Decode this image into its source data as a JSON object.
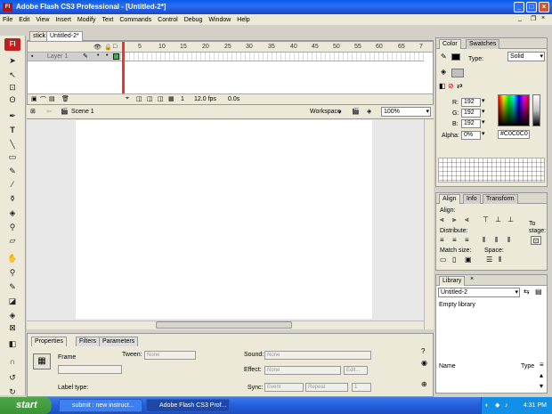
{
  "window": {
    "title": "Adobe Flash CS3 Professional - [Untitled-2*]"
  },
  "menu": [
    "File",
    "Edit",
    "View",
    "Insert",
    "Modify",
    "Text",
    "Commands",
    "Control",
    "Debug",
    "Window",
    "Help"
  ],
  "doc_tabs": [
    "stick",
    "Untitled-2*"
  ],
  "timeline": {
    "ruler": [
      "5",
      "10",
      "15",
      "20",
      "25",
      "30",
      "35",
      "40",
      "45",
      "50",
      "55",
      "60",
      "65",
      "7"
    ],
    "layer": "Layer 1",
    "current_frame": "1",
    "fps": "12.0 fps",
    "time": "0.0s"
  },
  "editbar": {
    "scene": "Scene 1",
    "workspace": "Workspace",
    "zoom": "100%"
  },
  "properties": {
    "tabs": [
      "Properties",
      "Filters",
      "Parameters"
    ],
    "frame_label": "Frame",
    "tween_label": "Tween:",
    "tween_value": "None",
    "sound_label": "Sound:",
    "sound_value": "None",
    "effect_label": "Effect:",
    "effect_value": "None",
    "edit_button": "Edit...",
    "sync_label": "Sync:",
    "sync_value": "Event",
    "repeat_value": "Repeat",
    "repeat_count": "1",
    "label_type": "Label type:"
  },
  "color_panel": {
    "tabs": [
      "Color",
      "Swatches"
    ],
    "type_label": "Type:",
    "type_value": "Solid",
    "r_label": "R:",
    "r": "192",
    "g_label": "G:",
    "g": "192",
    "b_label": "B:",
    "b": "192",
    "alpha_label": "Alpha:",
    "alpha": "0%",
    "hex": "#C0C0C0",
    "hex_color": "#c0c0c0"
  },
  "align_panel": {
    "tabs": [
      "Align",
      "Info",
      "Transform"
    ],
    "align_label": "Align:",
    "distribute_label": "Distribute:",
    "match_label": "Match size:",
    "space_label": "Space:",
    "to_stage_label": "To stage:"
  },
  "library_panel": {
    "tab": "Library",
    "doc": "Untitled-2",
    "empty": "Empty library",
    "col_name": "Name",
    "col_type": "Type"
  },
  "taskbar": {
    "start": "start",
    "tasks": [
      "submit : new instruct...",
      "Adobe Flash CS3 Prof..."
    ],
    "clock": "4:31 PM"
  }
}
